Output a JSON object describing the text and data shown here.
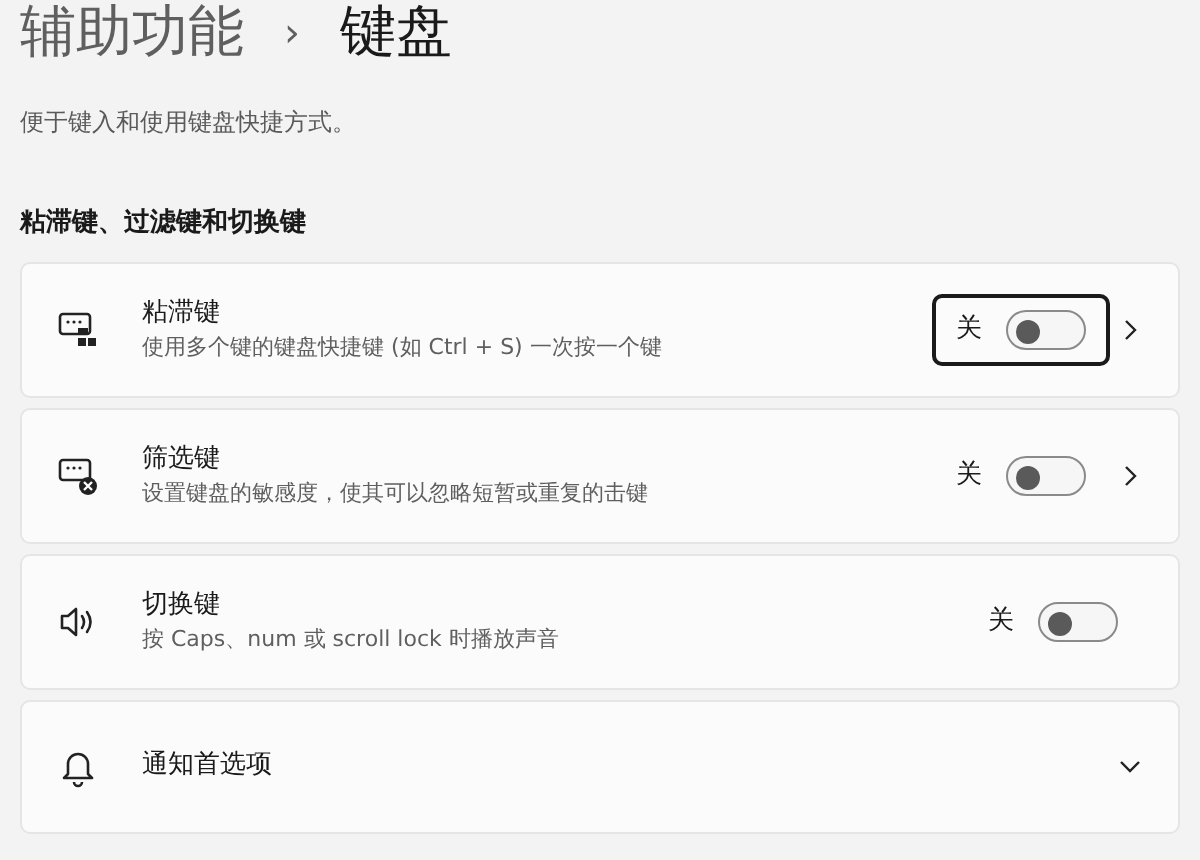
{
  "breadcrumb": {
    "parent": "辅助功能",
    "separator": "›",
    "current": "键盘"
  },
  "description": "便于键入和使用键盘快捷方式。",
  "section_title": "粘滞键、过滤键和切换键",
  "settings": [
    {
      "kind": "toggle",
      "title": "粘滞键",
      "subtitle": "使用多个键的键盘快捷键 (如 Ctrl + S) 一次按一个键",
      "state_label": "关",
      "on": false,
      "focused": true,
      "chevron": true
    },
    {
      "kind": "toggle",
      "title": "筛选键",
      "subtitle": "设置键盘的敏感度，使其可以忽略短暂或重复的击键",
      "state_label": "关",
      "on": false,
      "focused": false,
      "chevron": true
    },
    {
      "kind": "toggle",
      "title": "切换键",
      "subtitle": "按 Caps、num 或 scroll lock 时播放声音",
      "state_label": "关",
      "on": false,
      "focused": false,
      "chevron": false
    },
    {
      "kind": "expander",
      "title": "通知首选项",
      "expanded": false
    }
  ]
}
